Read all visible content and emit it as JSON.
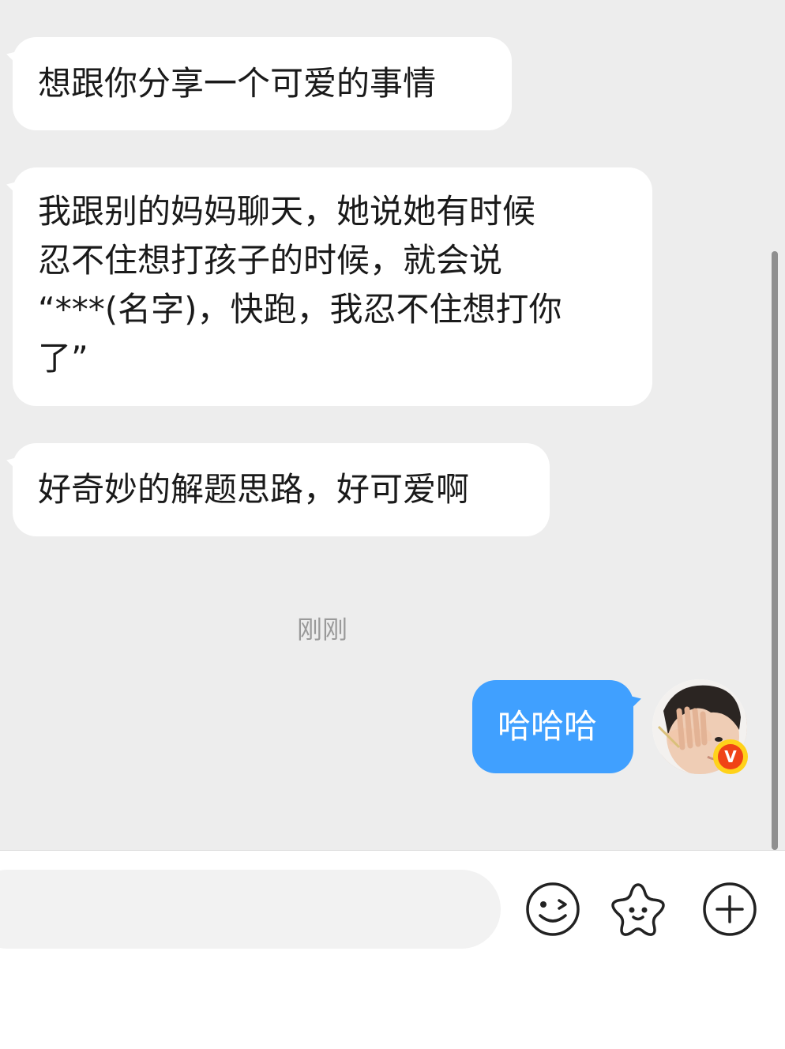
{
  "messages": [
    {
      "direction": "incoming",
      "text": "想跟你分享一个可爱的事情"
    },
    {
      "direction": "incoming",
      "lines": [
        "我跟别的妈妈聊天，她说她有时候",
        "忍不住想打孩子的时候，就会说",
        "“***(名字)，快跑，我忍不住想打你",
        "了”"
      ]
    },
    {
      "direction": "incoming",
      "text": "好奇妙的解题思路，好可爱啊"
    },
    {
      "direction": "outgoing",
      "text": "哈哈哈"
    }
  ],
  "timestamp": "刚刚",
  "avatar": {
    "badge_letter": "V"
  },
  "colors": {
    "chat_background": "#ededed",
    "incoming_bubble": "#ffffff",
    "outgoing_bubble": "#40a0ff",
    "badge_ring": "#ffd21a",
    "badge_fill": "#f04316"
  },
  "input": {
    "value": "",
    "placeholder": ""
  },
  "toolbar": {
    "icons": [
      "emoji-icon",
      "sticker-icon",
      "plus-icon"
    ]
  }
}
